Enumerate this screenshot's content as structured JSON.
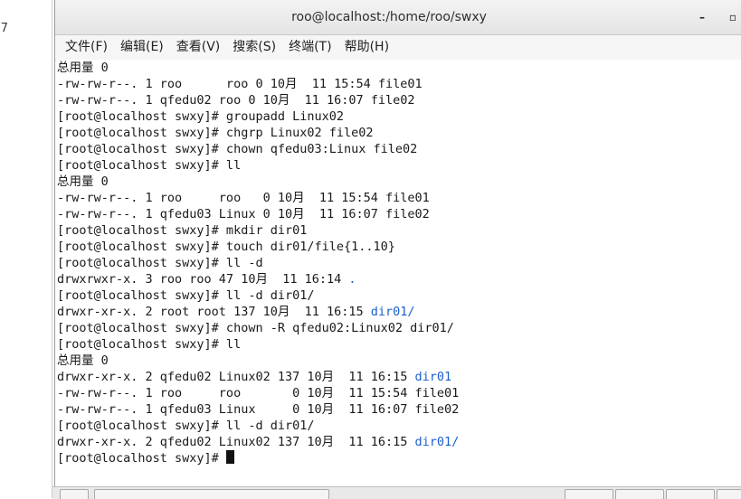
{
  "gutter": {
    "number": "7"
  },
  "window": {
    "title": "roo@localhost:/home/roo/swxy",
    "minimize_glyph": "–",
    "maximize_glyph": "▫"
  },
  "menu": [
    "文件(F)",
    "编辑(E)",
    "查看(V)",
    "搜索(S)",
    "终端(T)",
    "帮助(H)"
  ],
  "terminal": {
    "prompt": "[root@localhost swxy]# ",
    "lines": [
      {
        "text": "总用量 0"
      },
      {
        "text": "-rw-rw-r--. 1 roo      roo 0 10月  11 15:54 file01"
      },
      {
        "text": "-rw-rw-r--. 1 qfedu02 roo 0 10月  11 16:07 file02"
      },
      {
        "text": "[root@localhost swxy]# groupadd Linux02"
      },
      {
        "text": "[root@localhost swxy]# chgrp Linux02 file02"
      },
      {
        "text": "[root@localhost swxy]# chown qfedu03:Linux file02"
      },
      {
        "text": "[root@localhost swxy]# ll"
      },
      {
        "text": "总用量 0"
      },
      {
        "text": "-rw-rw-r--. 1 roo     roo   0 10月  11 15:54 file01"
      },
      {
        "text": "-rw-rw-r--. 1 qfedu03 Linux 0 10月  11 16:07 file02"
      },
      {
        "text": "[root@localhost swxy]# mkdir dir01"
      },
      {
        "text": "[root@localhost swxy]# touch dir01/file{1..10}"
      },
      {
        "text": "[root@localhost swxy]# ll -d"
      },
      {
        "text": "drwxrwxr-x. 3 roo roo 47 10月  11 16:14 ",
        "blue": "."
      },
      {
        "text": "[root@localhost swxy]# ll -d dir01/"
      },
      {
        "text": "drwxr-xr-x. 2 root root 137 10月  11 16:15 ",
        "blue": "dir01/"
      },
      {
        "text": "[root@localhost swxy]# chown -R qfedu02:Linux02 dir01/"
      },
      {
        "text": "[root@localhost swxy]# ll"
      },
      {
        "text": "总用量 0"
      },
      {
        "text": "drwxr-xr-x. 2 qfedu02 Linux02 137 10月  11 16:15 ",
        "blue": "dir01"
      },
      {
        "text": "-rw-rw-r--. 1 roo     roo       0 10月  11 15:54 file01"
      },
      {
        "text": "-rw-rw-r--. 1 qfedu03 Linux     0 10月  11 16:07 file02"
      },
      {
        "text": "[root@localhost swxy]# ll -d dir01/"
      },
      {
        "text": "drwxr-xr-x. 2 qfedu02 Linux02 137 10月  11 16:15 ",
        "blue": "dir01/"
      }
    ]
  },
  "colors": {
    "link_blue": "#1c5fcf",
    "terminal_bg": "#ffffff",
    "text": "#1a1a1a"
  }
}
